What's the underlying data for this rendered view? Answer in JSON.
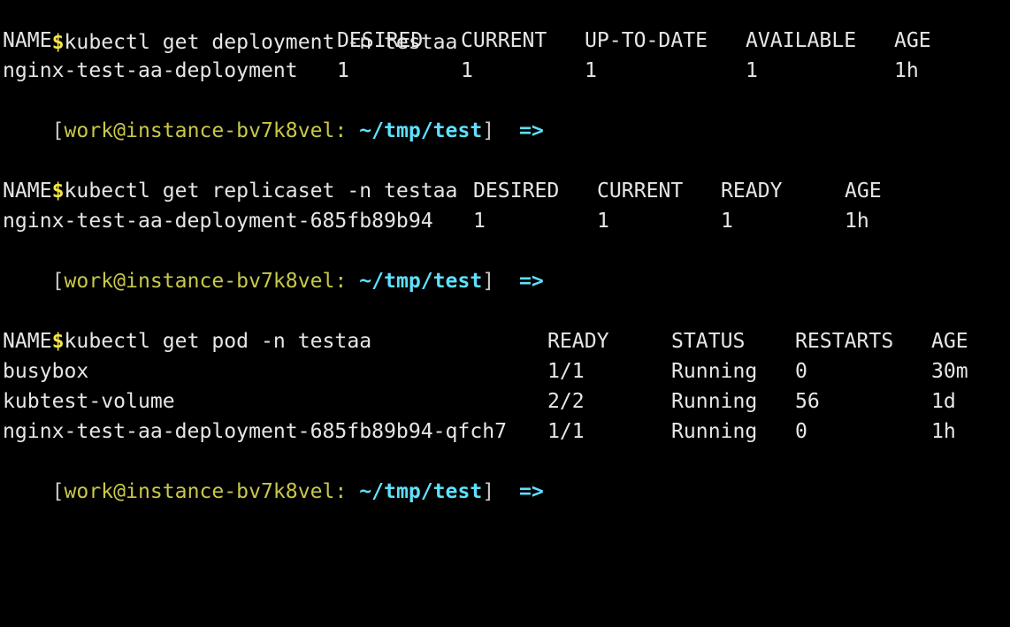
{
  "prompt": {
    "open_bracket": "[",
    "user_host": "work@instance-bv7k8vel:",
    "path": "~/tmp/test",
    "close_bracket": "]",
    "arrow": "=>"
  },
  "blocks": [
    {
      "dollar": "$",
      "command": "kubectl get deployment -n testaa",
      "headers": [
        "NAME",
        "DESIRED",
        "CURRENT",
        "UP-TO-DATE",
        "AVAILABLE",
        "AGE"
      ],
      "rows": [
        [
          "nginx-test-aa-deployment",
          "1",
          "1",
          "1",
          "1",
          "1h"
        ]
      ]
    },
    {
      "dollar": "$",
      "command": "kubectl get replicaset -n testaa",
      "headers": [
        "NAME",
        "DESIRED",
        "CURRENT",
        "READY",
        "AGE"
      ],
      "rows": [
        [
          "nginx-test-aa-deployment-685fb89b94",
          "1",
          "1",
          "1",
          "1h"
        ]
      ]
    },
    {
      "dollar": "$",
      "command": "kubectl get pod -n testaa",
      "headers": [
        "NAME",
        "READY",
        "STATUS",
        "RESTARTS",
        "AGE"
      ],
      "rows": [
        [
          "busybox",
          "1/1",
          "Running",
          "0",
          "30m"
        ],
        [
          "kubtest-volume",
          "2/2",
          "Running",
          "56",
          "1d"
        ],
        [
          "nginx-test-aa-deployment-685fb89b94-qfch7",
          "1/1",
          "Running",
          "0",
          "1h"
        ]
      ]
    }
  ]
}
